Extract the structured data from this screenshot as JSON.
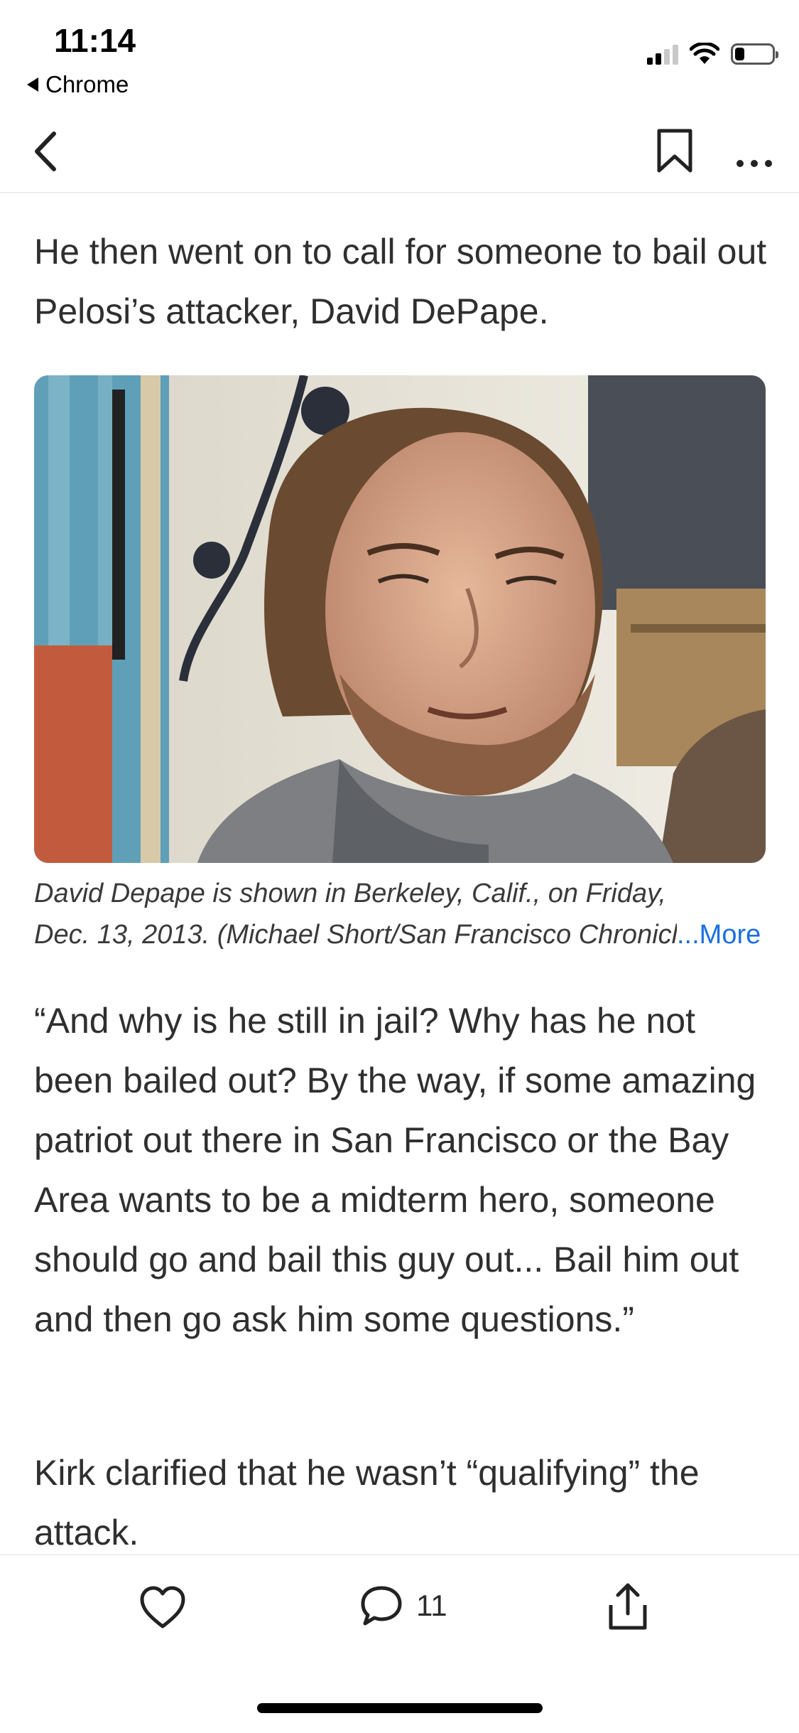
{
  "status_bar": {
    "time": "11:14",
    "back_app": "Chrome",
    "signal_bars_active": 2,
    "signal_bars_total": 4,
    "battery_level": 0.25
  },
  "nav": {
    "icons": [
      "chevron-left-icon",
      "bookmark-icon",
      "more-icon"
    ]
  },
  "article": {
    "paragraph_1": "He then went on to call for someone to bail out Pelosi’s attacker, David DePape.",
    "image_caption_line1": "David Depape is shown in Berkeley, Calif., on Friday,",
    "image_caption_line2": "Dec. 13, 2013. (Michael Short/San Francisco Chronicle",
    "caption_more": "...More",
    "paragraph_2": "“And why is he still in jail? Why has he not been bailed out? By the way, if some amazing patriot out there in San Francisco or the Bay Area wants to be a midterm hero, someone should go and bail this guy out... Bail him out and then go ask him some questions.”",
    "paragraph_3": "Kirk clarified that he wasn’t “qualifying” the attack."
  },
  "actions": {
    "comment_count": "11",
    "icons": [
      "heart-icon",
      "comment-icon",
      "share-icon"
    ]
  },
  "colors": {
    "link": "#1a6fe0",
    "text": "#2f2f2f"
  }
}
